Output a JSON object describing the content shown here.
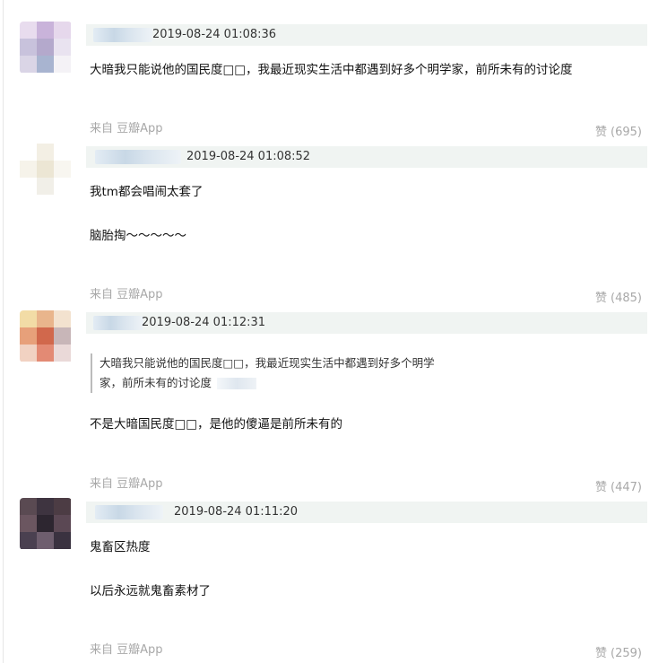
{
  "comments": [
    {
      "timestamp": "2019-08-24 01:08:36",
      "lines": [
        "大暗我只能说他的国民度□□，我最近现实生活中都遇到好多个明学家，前所未有的讨论度"
      ],
      "source": "来自 豆瓣App",
      "like_label": "赞",
      "like_count": "(695)"
    },
    {
      "timestamp": "2019-08-24 01:08:52",
      "lines": [
        "我tm都会唱闹太套了",
        "脑胎掏～～～～～"
      ],
      "source": "来自 豆瓣App",
      "like_label": "赞",
      "like_count": "(485)"
    },
    {
      "timestamp": "2019-08-24 01:12:31",
      "quote": [
        "大暗我只能说他的国民度□□，我最近现实生活中都遇到好多个明学",
        "家，前所未有的讨论度"
      ],
      "lines": [
        "不是大暗国民度□□，是他的傻逼是前所未有的"
      ],
      "source": "来自 豆瓣App",
      "like_label": "赞",
      "like_count": "(447)"
    },
    {
      "timestamp": "2019-08-24 01:11:20",
      "lines": [
        "鬼畜区热度",
        "以后永远就鬼畜素材了"
      ],
      "source": "来自 豆瓣App",
      "like_label": "赞",
      "like_count": "(259)"
    }
  ],
  "colors": {
    "meta_bar": "#f0f4f2",
    "source_text": "#a8a8a8",
    "body_text": "#111111"
  }
}
